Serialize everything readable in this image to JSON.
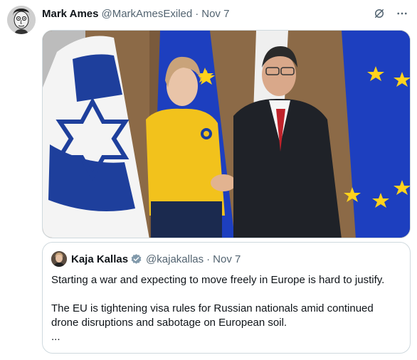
{
  "tweet": {
    "author_name": "Mark Ames",
    "author_handle": "@MarkAmesExiled",
    "separator": "·",
    "date": "Nov 7",
    "avatar_icon": "cartoon-face-avatar",
    "grok_icon": "grok-icon",
    "more_icon": "more-dots-icon",
    "more_label": "···"
  },
  "photo": {
    "description_icon": "photo-icon",
    "flag_colors": {
      "israel_blue": "#1e3f9c",
      "eu_blue": "#1d3fbf",
      "eu_star": "#ffd21c",
      "wall": "#8a6a48"
    }
  },
  "quote": {
    "author_name": "Kaja Kallas",
    "author_handle": "@kajakallas",
    "separator": "·",
    "date": "Nov 7",
    "verified_icon": "verified-badge-icon",
    "line1": "Starting a war and expecting to move freely in Europe is hard to justify.",
    "line2": "The EU is tightening visa rules for Russian nationals amid continued drone disruptions and sabotage on European soil.",
    "ellipsis": "..."
  }
}
